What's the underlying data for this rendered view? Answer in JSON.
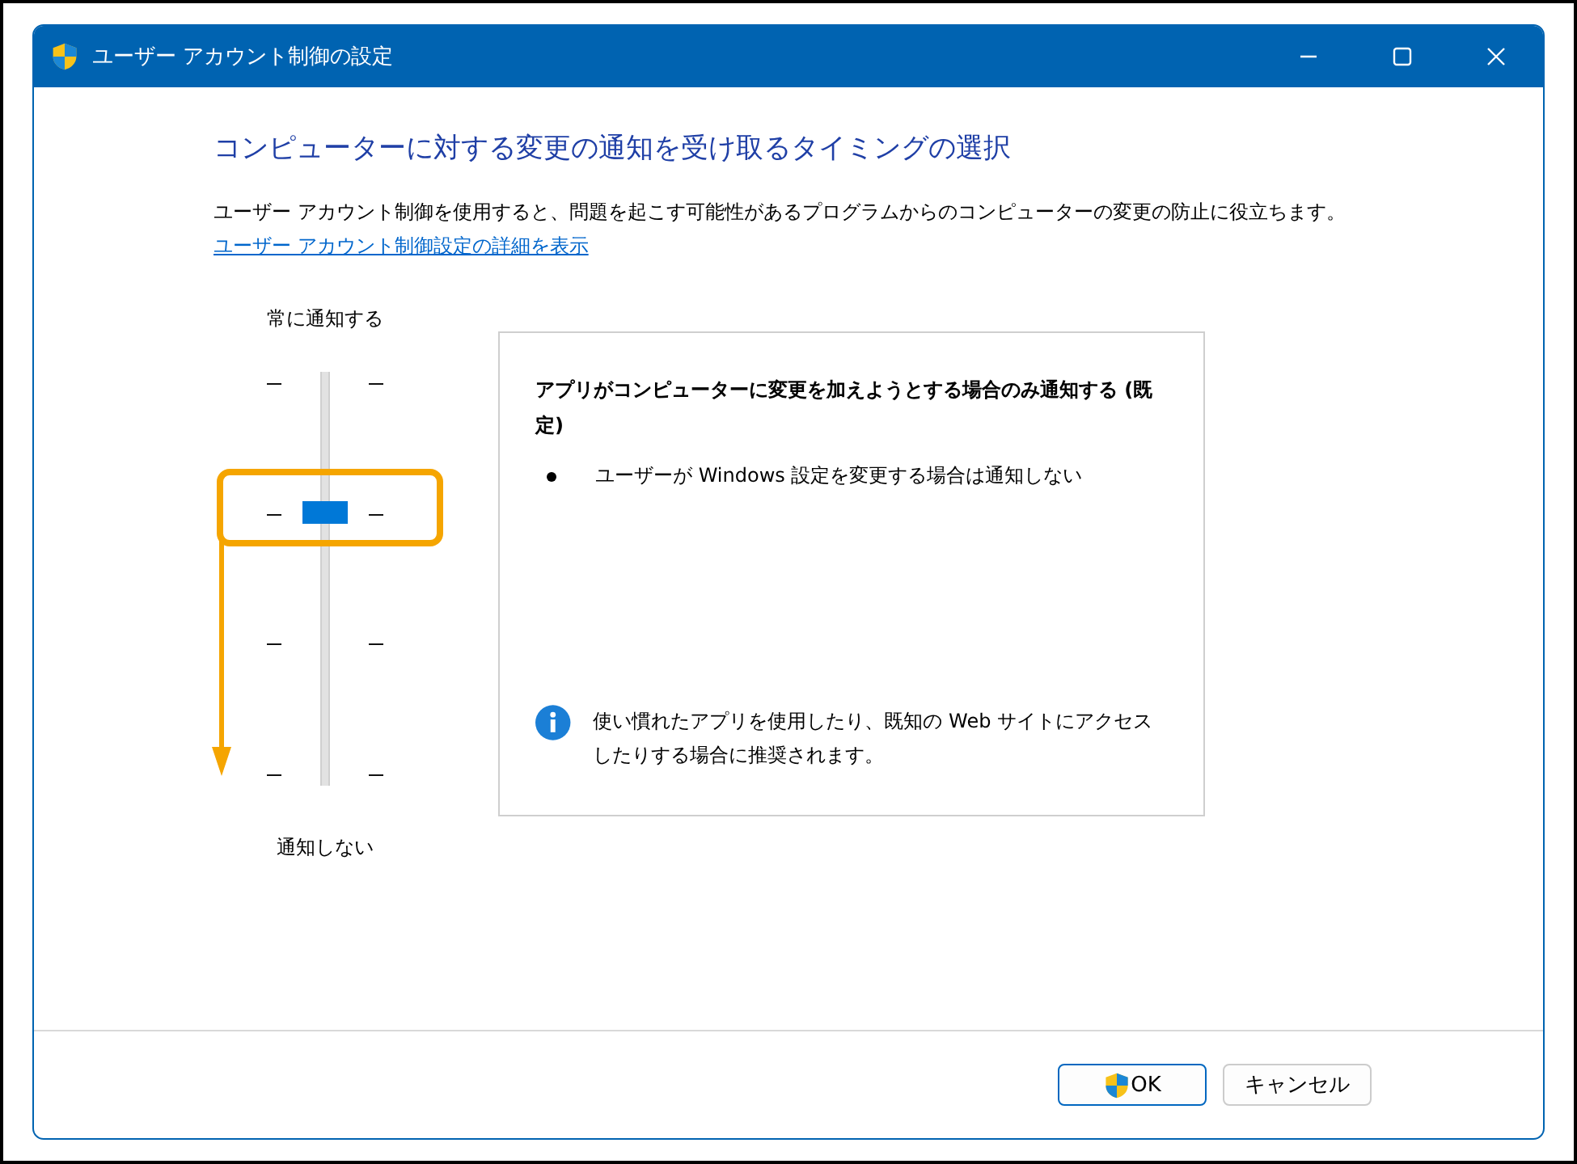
{
  "window": {
    "title": "ユーザー アカウント制御の設定"
  },
  "heading": "コンピューターに対する変更の通知を受け取るタイミングの選択",
  "description": "ユーザー アカウント制御を使用すると、問題を起こす可能性があるプログラムからのコンピューターの変更の防止に役立ちます。",
  "details_link": "ユーザー アカウント制御設定の詳細を表示",
  "slider": {
    "top_label": "常に通知する",
    "bottom_label": "通知しない",
    "level": 0.667
  },
  "info_panel": {
    "title": "アプリがコンピューターに変更を加えようとする場合のみ通知する (既定)",
    "bullets": [
      "ユーザーが Windows 設定を変更する場合は通知しない"
    ],
    "note": "使い慣れたアプリを使用したり、既知の Web サイトにアクセスしたりする場合に推奨されます。"
  },
  "buttons": [
    {
      "label": "OK",
      "kind": "shield"
    },
    {
      "label": "キャンセル",
      "kind": "plain"
    }
  ]
}
